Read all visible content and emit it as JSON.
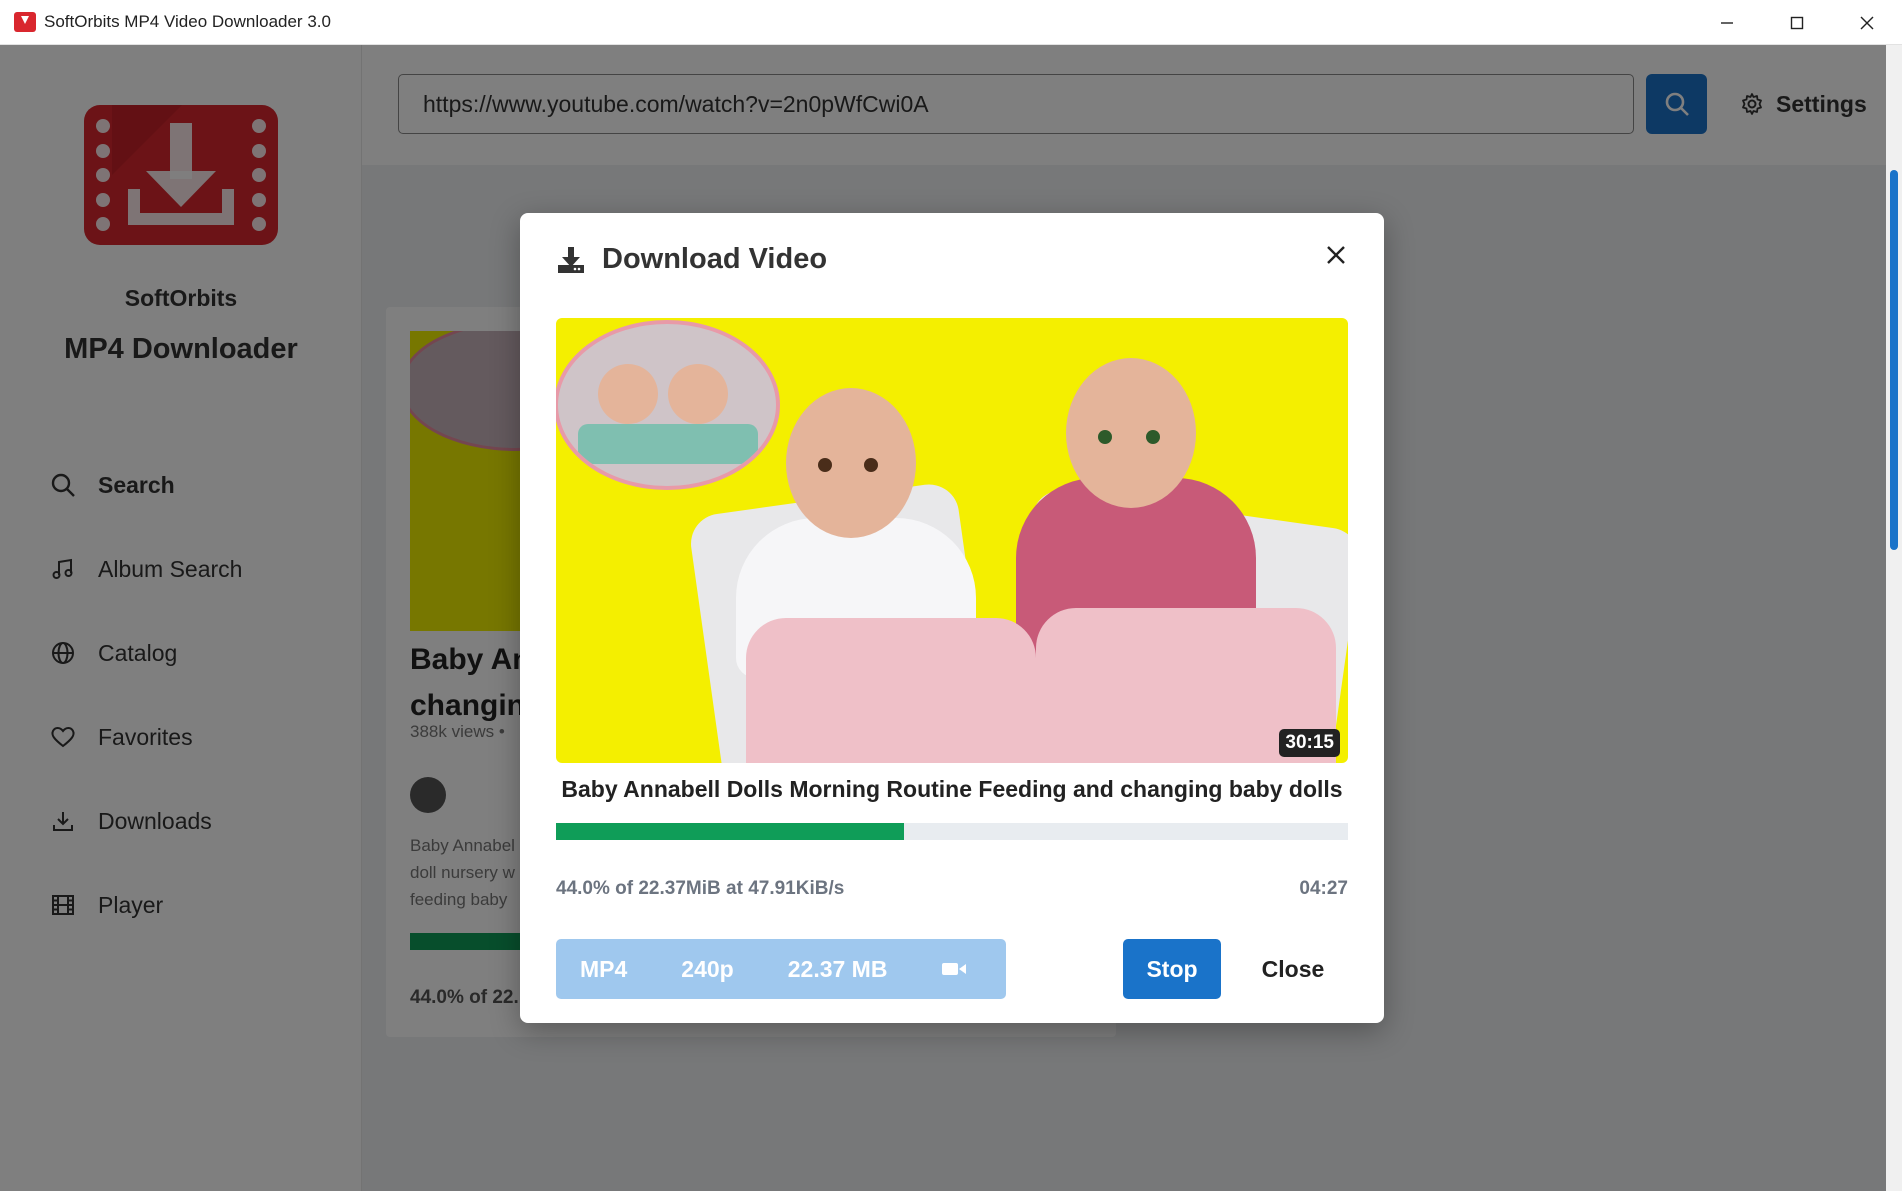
{
  "window": {
    "title": "SoftOrbits MP4 Video Downloader 3.0",
    "controls": [
      "minimize-icon",
      "maximize-icon",
      "close-icon"
    ]
  },
  "sidebar": {
    "brand_line1": "SoftOrbits",
    "brand_line2": "MP4 Downloader",
    "items": [
      {
        "label": "Search",
        "icon": "search-icon",
        "active": true
      },
      {
        "label": "Album Search",
        "icon": "music-note-icon"
      },
      {
        "label": "Catalog",
        "icon": "globe-icon"
      },
      {
        "label": "Favorites",
        "icon": "heart-icon"
      },
      {
        "label": "Downloads",
        "icon": "download-icon"
      },
      {
        "label": "Player",
        "icon": "film-icon"
      }
    ]
  },
  "topbar": {
    "url_value": "https://www.youtube.com/watch?v=2n0pWfCwi0A",
    "search_icon": "search-icon",
    "settings_label": "Settings",
    "settings_icon": "gear-icon"
  },
  "card": {
    "title_line1": "Baby An",
    "title_line2": "changin",
    "views": "388k views  •",
    "desc_line1": "Baby Annabel",
    "desc_line2": "doll nursery w",
    "desc_line3": "feeding baby",
    "progress": 0.44,
    "status": "44.0% of 22."
  },
  "modal": {
    "title": "Download Video",
    "title_icon": "download-icon",
    "close_icon": "close-icon",
    "duration": "30:15",
    "video_title": "Baby Annabell Dolls Morning Routine Feeding and changing baby dolls",
    "progress": 0.44,
    "status_text": "44.0% of 22.37MiB at 47.91KiB/s",
    "time_left": "04:27",
    "format": {
      "container": "MP4",
      "resolution": "240p",
      "size": "22.37 MB",
      "icon": "video-camera-icon"
    },
    "stop_label": "Stop",
    "close_label": "Close"
  },
  "colors": {
    "accent": "#1a73c9",
    "progress": "#0f9d58",
    "brand_red": "#d9272e",
    "format_box": "#9fc8ee",
    "thumbnail_bg": "#f4ef00"
  }
}
